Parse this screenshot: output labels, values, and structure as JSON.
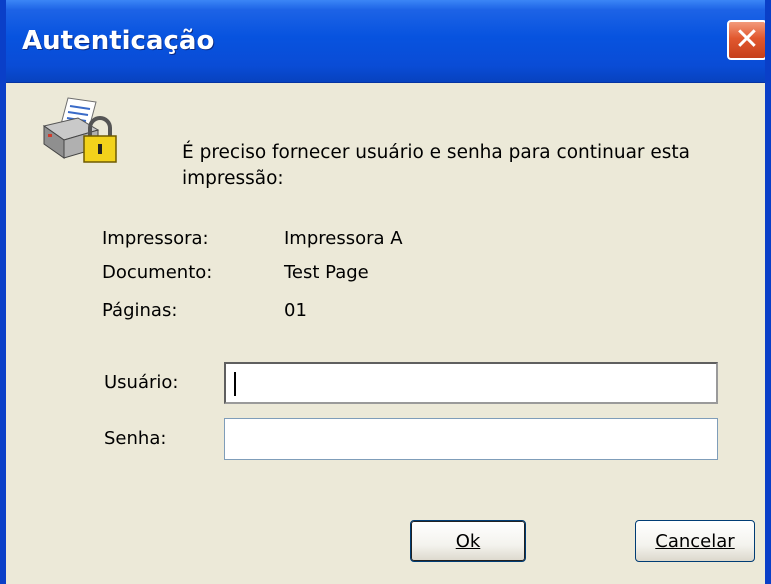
{
  "window": {
    "title": "Autenticação",
    "close_glyph": "✕"
  },
  "message": "É preciso fornecer usuário e senha para continuar esta impressão:",
  "info": [
    {
      "label": "Impressora:",
      "value": "Impressora A"
    },
    {
      "label": "Documento:",
      "value": "Test Page"
    },
    {
      "label": "Páginas:",
      "value": "01"
    }
  ],
  "form": {
    "user_label": "Usuário:",
    "user_value": "",
    "password_label": "Senha:",
    "password_value": ""
  },
  "buttons": {
    "ok": "Ok",
    "cancel": "Cancelar"
  },
  "icons": {
    "header": "printer-lock-icon"
  },
  "colors": {
    "titlebar": "#0753DF",
    "dialog_bg": "#ECE9D8",
    "close": "#E1582F"
  }
}
